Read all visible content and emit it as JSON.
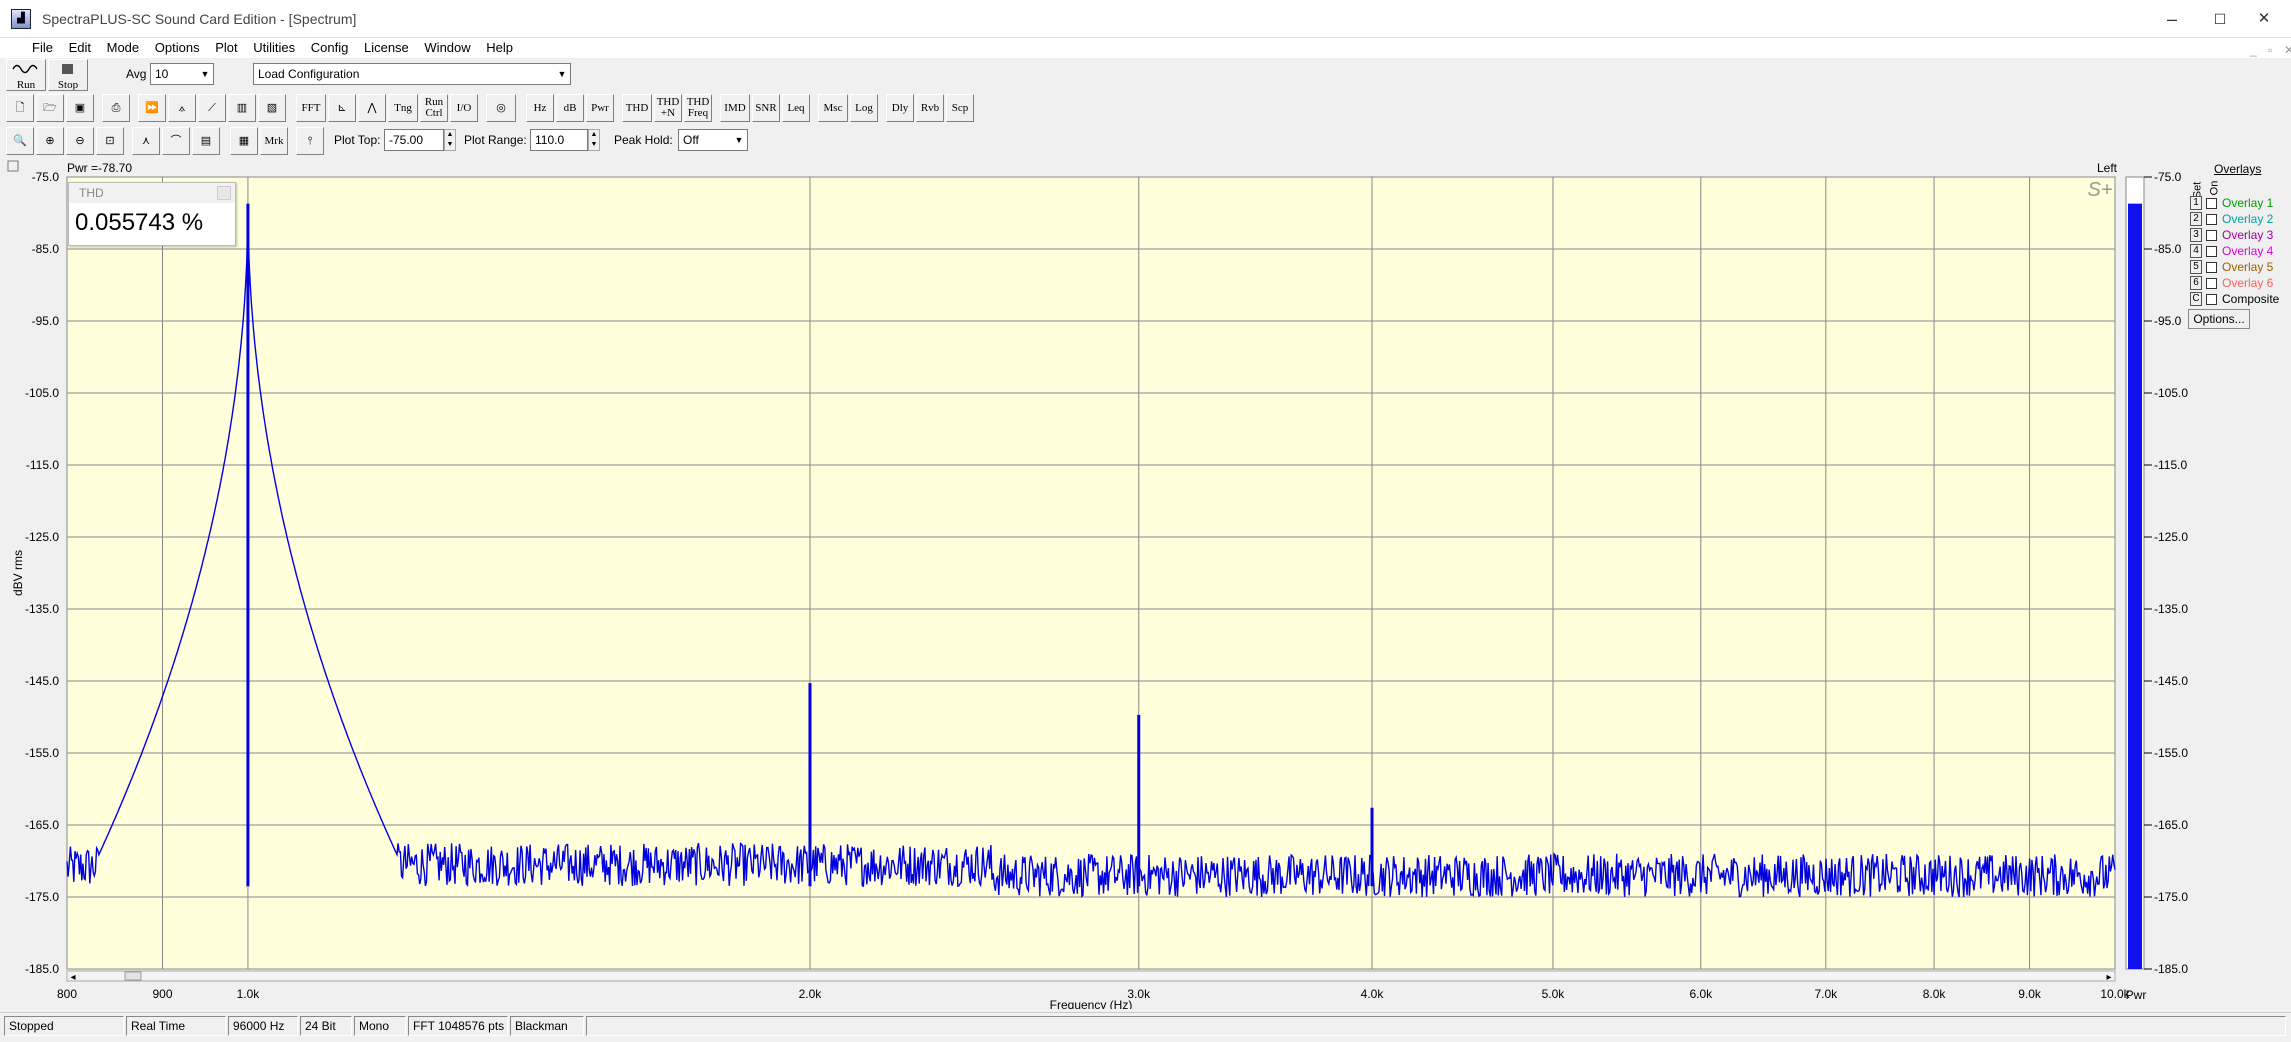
{
  "window": {
    "title": "SpectraPLUS-SC Sound Card Edition - [Spectrum]",
    "app_icon": "spectrum-app-icon",
    "minimize": "–",
    "maximize": "☐",
    "close": "✕"
  },
  "menu": [
    "File",
    "Edit",
    "Mode",
    "Options",
    "Plot",
    "Utilities",
    "Config",
    "License",
    "Window",
    "Help"
  ],
  "mdi_controls": [
    "_",
    "▫",
    "✕"
  ],
  "toolbar1": {
    "run_label": "Run",
    "stop_label": "Stop",
    "avg_label": "Avg",
    "avg_value": "10",
    "config_value": "Load Configuration"
  },
  "toolbar2": [
    "FFT",
    "Tng",
    "Run Ctrl",
    "I/O",
    "Hz",
    "dB",
    "Pwr",
    "THD",
    "THD +N",
    "THD Freq",
    "IMD",
    "SNR",
    "Leq",
    "Msc",
    "Log",
    "Dly",
    "Rvb",
    "Scp"
  ],
  "toolbar3": {
    "mrk_label": "Mrk",
    "plot_top_label": "Plot Top:",
    "plot_top_value": "-75.00",
    "plot_range_label": "Plot Range:",
    "plot_range_value": "110.0",
    "peak_hold_label": "Peak Hold:",
    "peak_hold_value": "Off"
  },
  "plot": {
    "pwr_readout": "Pwr =-78.70",
    "channel_label": "Left",
    "thd_title": "THD",
    "thd_value": "0.055743 %",
    "logo": "S+",
    "bar_label": "Pwr"
  },
  "overlays": {
    "title": "Overlays",
    "col_set": "Set",
    "col_on": "On",
    "items": [
      {
        "num": "1",
        "label": "Overlay 1",
        "color": "#00a000"
      },
      {
        "num": "2",
        "label": "Overlay 2",
        "color": "#00a0a0"
      },
      {
        "num": "3",
        "label": "Overlay 3",
        "color": "#a000a0"
      },
      {
        "num": "4",
        "label": "Overlay 4",
        "color": "#e000e0"
      },
      {
        "num": "5",
        "label": "Overlay 5",
        "color": "#a06000"
      },
      {
        "num": "6",
        "label": "Overlay 6",
        "color": "#ff6060"
      },
      {
        "num": "C",
        "label": "Composite",
        "color": "#000000"
      }
    ],
    "options_label": "Options..."
  },
  "status": [
    "Stopped",
    "Real Time",
    "96000 Hz",
    "24 Bit",
    "Mono",
    "FFT 1048576 pts",
    "Blackman"
  ],
  "chart_data": {
    "type": "line",
    "xlabel": "Frequency (Hz)",
    "ylabel": "dBV rms",
    "x_scale": "log",
    "xlim": [
      800,
      10000
    ],
    "ylim": [
      -185,
      -75
    ],
    "x_ticks": [
      {
        "v": 800,
        "l": "800"
      },
      {
        "v": 900,
        "l": "900"
      },
      {
        "v": 1000,
        "l": "1.0k"
      },
      {
        "v": 2000,
        "l": "2.0k"
      },
      {
        "v": 3000,
        "l": "3.0k"
      },
      {
        "v": 4000,
        "l": "4.0k"
      },
      {
        "v": 5000,
        "l": "5.0k"
      },
      {
        "v": 6000,
        "l": "6.0k"
      },
      {
        "v": 7000,
        "l": "7.0k"
      },
      {
        "v": 8000,
        "l": "8.0k"
      },
      {
        "v": 9000,
        "l": "9.0k"
      },
      {
        "v": 10000,
        "l": "10.0k"
      }
    ],
    "y_ticks": [
      -75,
      -85,
      -95,
      -105,
      -115,
      -125,
      -135,
      -145,
      -155,
      -165,
      -175,
      -185
    ],
    "bar_ticks": [
      -75,
      -85,
      -95,
      -105,
      -115,
      -125,
      -135,
      -145,
      -155,
      -165,
      -175,
      -185
    ],
    "grid": true,
    "line_color": "#0000e0",
    "plot_bg": "#ffffdc",
    "noise_floor": -173.5,
    "peaks": [
      {
        "x": 1000,
        "y": -78.7
      },
      {
        "x": 2000,
        "y": -145.3
      },
      {
        "x": 3000,
        "y": -149.7
      },
      {
        "x": 4000,
        "y": -162.6
      }
    ],
    "level_bar": {
      "value": -78.7
    }
  }
}
